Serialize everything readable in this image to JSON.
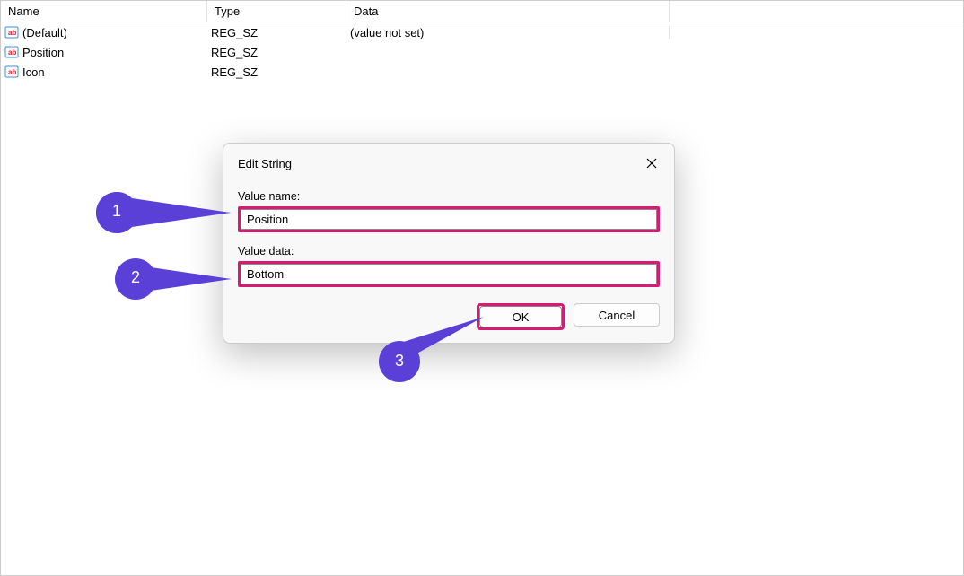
{
  "columns": {
    "name": "Name",
    "type": "Type",
    "data": "Data"
  },
  "rows": [
    {
      "name": "(Default)",
      "type": "REG_SZ",
      "data": "(value not set)"
    },
    {
      "name": "Position",
      "type": "REG_SZ",
      "data": ""
    },
    {
      "name": "Icon",
      "type": "REG_SZ",
      "data": ""
    }
  ],
  "dialog": {
    "title": "Edit String",
    "value_name_label": "Value name:",
    "value_name": "Position",
    "value_data_label": "Value data:",
    "value_data": "Bottom",
    "ok": "OK",
    "cancel": "Cancel"
  },
  "callouts": {
    "one": "1",
    "two": "2",
    "three": "3"
  },
  "colors": {
    "highlight": "#d81b72",
    "callout": "#5a40d6"
  }
}
